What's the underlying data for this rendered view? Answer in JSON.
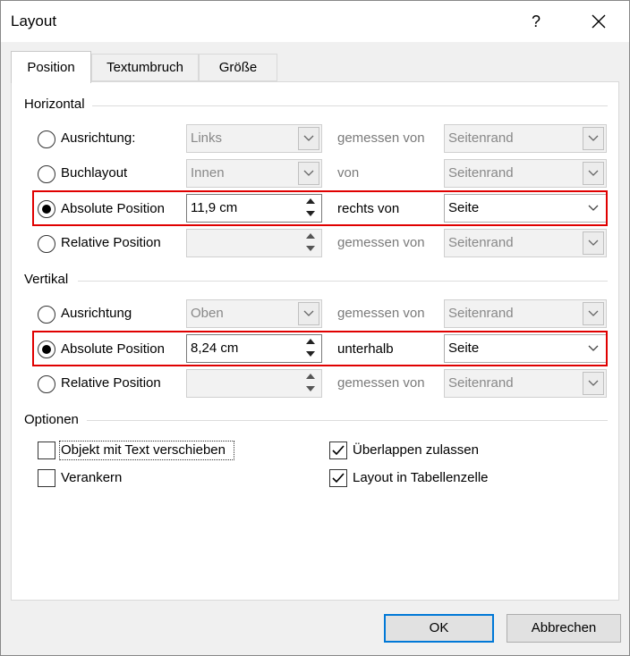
{
  "window": {
    "title": "Layout",
    "help_label": "?",
    "close_icon": "close-icon"
  },
  "tabs": [
    {
      "label": "Position",
      "active": true
    },
    {
      "label": "Textumbruch",
      "active": false
    },
    {
      "label": "Größe",
      "active": false
    }
  ],
  "horizontal": {
    "title": "Horizontal",
    "rows": [
      {
        "label": "Ausrichtung:",
        "selected": false,
        "input": "Links",
        "relation": "gemessen von",
        "reference": "Seitenrand",
        "enabled": false
      },
      {
        "label": "Buchlayout",
        "selected": false,
        "input": "Innen",
        "relation": "von",
        "reference": "Seitenrand",
        "enabled": false
      },
      {
        "label": "Absolute Position",
        "selected": true,
        "input": "11,9 cm",
        "relation": "rechts von",
        "reference": "Seite",
        "enabled": true
      },
      {
        "label": "Relative Position",
        "selected": false,
        "input": "",
        "relation": "gemessen von",
        "reference": "Seitenrand",
        "enabled": false
      }
    ]
  },
  "vertical": {
    "title": "Vertikal",
    "rows": [
      {
        "label": "Ausrichtung",
        "selected": false,
        "input": "Oben",
        "relation": "gemessen von",
        "reference": "Seitenrand",
        "enabled": false
      },
      {
        "label": "Absolute Position",
        "selected": true,
        "input": "8,24 cm",
        "relation": "unterhalb",
        "reference": "Seite",
        "enabled": true
      },
      {
        "label": "Relative Position",
        "selected": false,
        "input": "",
        "relation": "gemessen von",
        "reference": "Seitenrand",
        "enabled": false
      }
    ]
  },
  "options": {
    "title": "Optionen",
    "move_with_text": {
      "label": "Objekt mit Text verschieben",
      "checked": false
    },
    "anchor": {
      "label": "Verankern",
      "checked": false
    },
    "allow_overlap": {
      "label": "Überlappen zulassen",
      "checked": true
    },
    "layout_in_cell": {
      "label": "Layout in Tabellenzelle",
      "checked": true
    }
  },
  "buttons": {
    "ok": "OK",
    "cancel": "Abbrechen"
  },
  "colors": {
    "highlight": "#e00000",
    "default_button_border": "#0078d7"
  }
}
